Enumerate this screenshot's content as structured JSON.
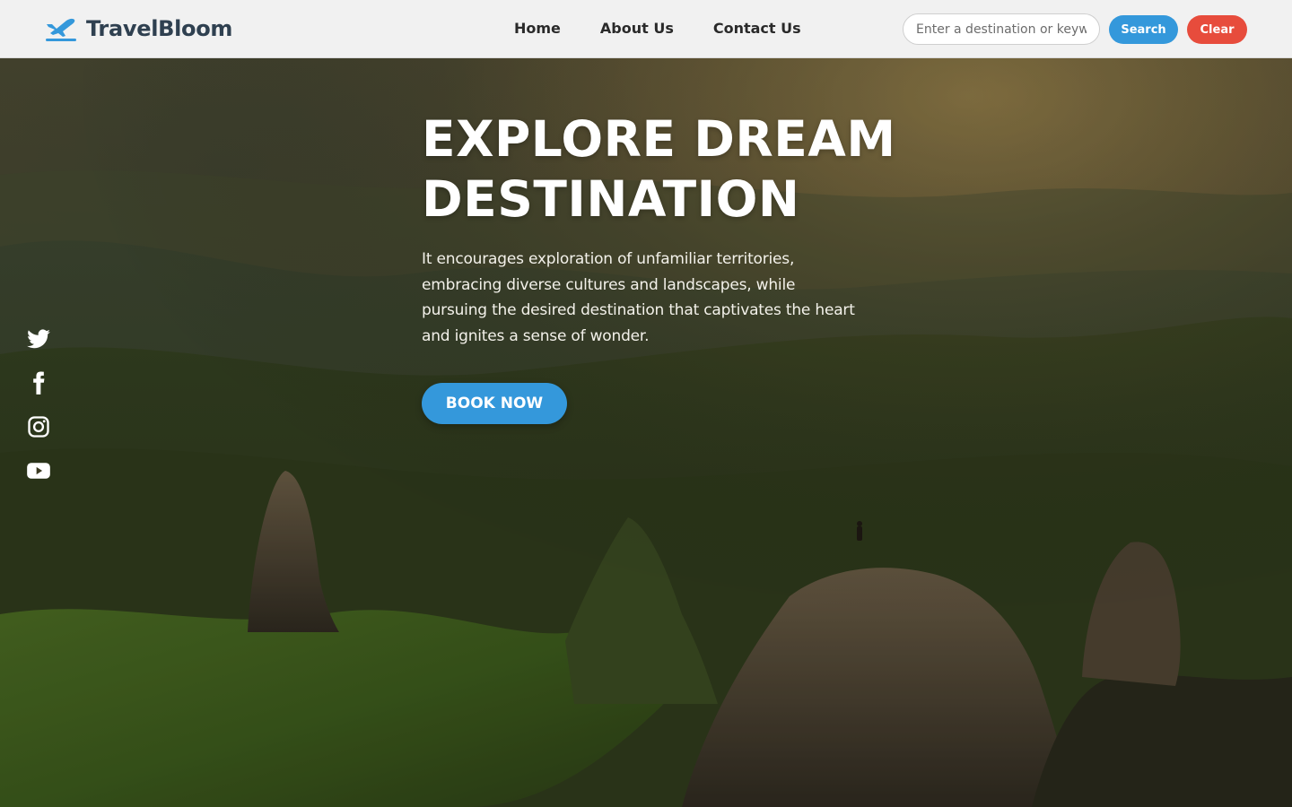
{
  "brand": {
    "name": "TravelBloom",
    "logo_icon": "airplane-icon"
  },
  "nav": {
    "items": [
      {
        "label": "Home"
      },
      {
        "label": "About Us"
      },
      {
        "label": "Contact Us"
      }
    ]
  },
  "search": {
    "placeholder": "Enter a destination or keyword",
    "value": "",
    "search_label": "Search",
    "clear_label": "Clear"
  },
  "hero": {
    "title_line1": "EXPLORE DREAM",
    "title_line2": "DESTINATION",
    "description": "It encourages exploration of unfamiliar territories, embracing diverse cultures and landscapes, while pursuing the desired destination that captivates the heart and ignites a sense of wonder.",
    "cta_label": "BOOK NOW"
  },
  "social": {
    "icons": [
      "twitter-icon",
      "facebook-icon",
      "instagram-icon",
      "youtube-icon"
    ]
  },
  "colors": {
    "accent": "#3498db",
    "danger": "#e74c3c",
    "brand_text": "#2f4050",
    "header_bg": "#f1f1f1"
  }
}
